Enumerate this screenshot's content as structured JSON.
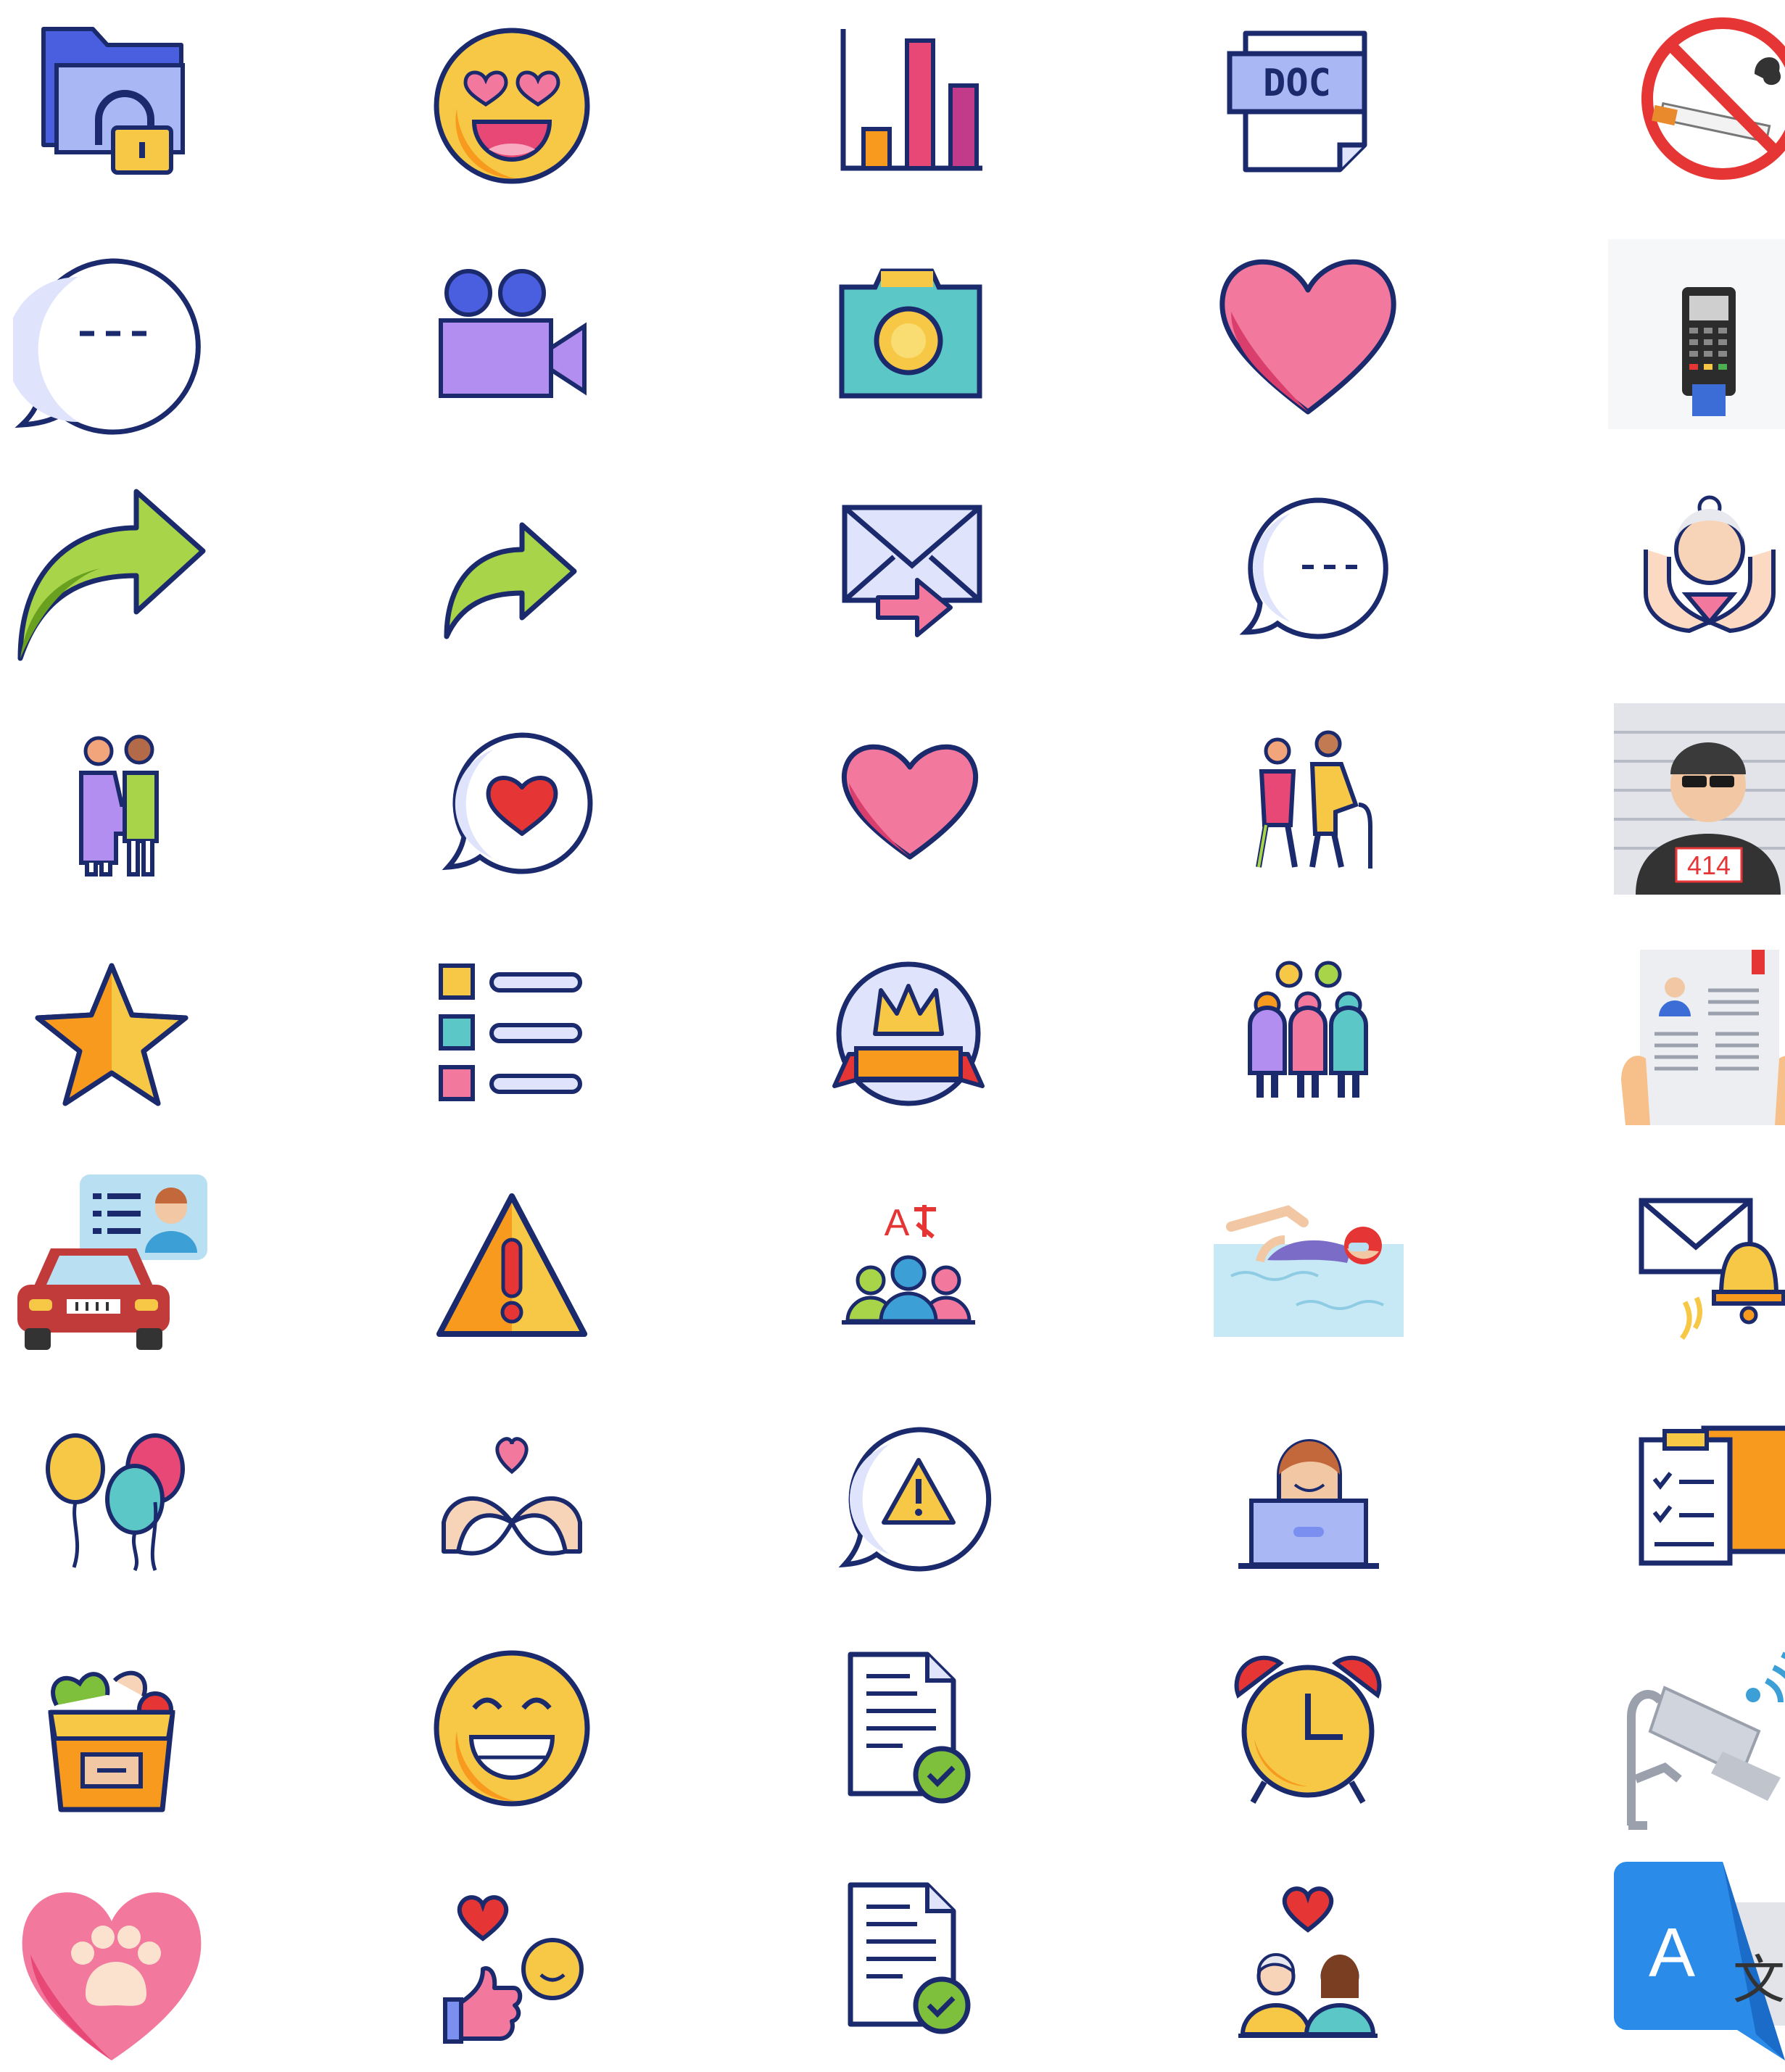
{
  "icon_grid": {
    "rows": [
      [
        "folder-lock-icon",
        "heart-eyes-emoji-icon",
        "bar-chart-icon",
        "doc-file-icon",
        "no-smoking-icon"
      ],
      [
        "speech-bubble-dots-icon",
        "video-camera-icon",
        "camera-icon",
        "heart-icon",
        "card-payment-terminal-icon"
      ],
      [
        "share-arrow-large-icon",
        "share-arrow-small-icon",
        "forward-mail-icon",
        "chat-dots-icon",
        "elderly-care-hands-icon"
      ],
      [
        "helping-elderly-icon",
        "chat-heart-icon",
        "heart-small-icon",
        "walking-elderly-icon",
        "mugshot-criminal-icon"
      ],
      [
        "star-icon",
        "checklist-icon",
        "crown-badge-icon",
        "group-people-icon",
        "newspaper-profile-icon"
      ],
      [
        "driver-license-car-icon",
        "warning-triangle-icon",
        "translation-group-icon",
        "swimmer-icon",
        "mail-notification-bell-icon"
      ],
      [
        "balloons-icon",
        "heart-hands-icon",
        "chat-warning-icon",
        "laptop-user-icon",
        "clipboard-checklist-icon"
      ],
      [
        "grocery-bag-icon",
        "smile-emoji-icon",
        "document-approved-icon",
        "alarm-clock-icon",
        "security-camera-wifi-icon"
      ],
      [
        "pet-paw-heart-icon",
        "like-smile-heart-icon",
        "document-check-icon",
        "couple-love-icon",
        "translate-app-icon"
      ]
    ]
  },
  "texts": {
    "doc_label": "DOC",
    "mugshot_number": "414",
    "translate_a": "A",
    "translate_char": "文",
    "group_a": "A"
  },
  "colors": {
    "outline": "#1a2a6c",
    "blue_light": "#7b8ff0",
    "blue_mid": "#4a5fe0",
    "yellow": "#f7c845",
    "orange": "#f79a1e",
    "pink": "#f2789e",
    "red": "#e63535",
    "teal": "#5cc7c7",
    "purple": "#b28ef0",
    "green": "#7ec03c",
    "bubble": "#dfe3fb"
  }
}
